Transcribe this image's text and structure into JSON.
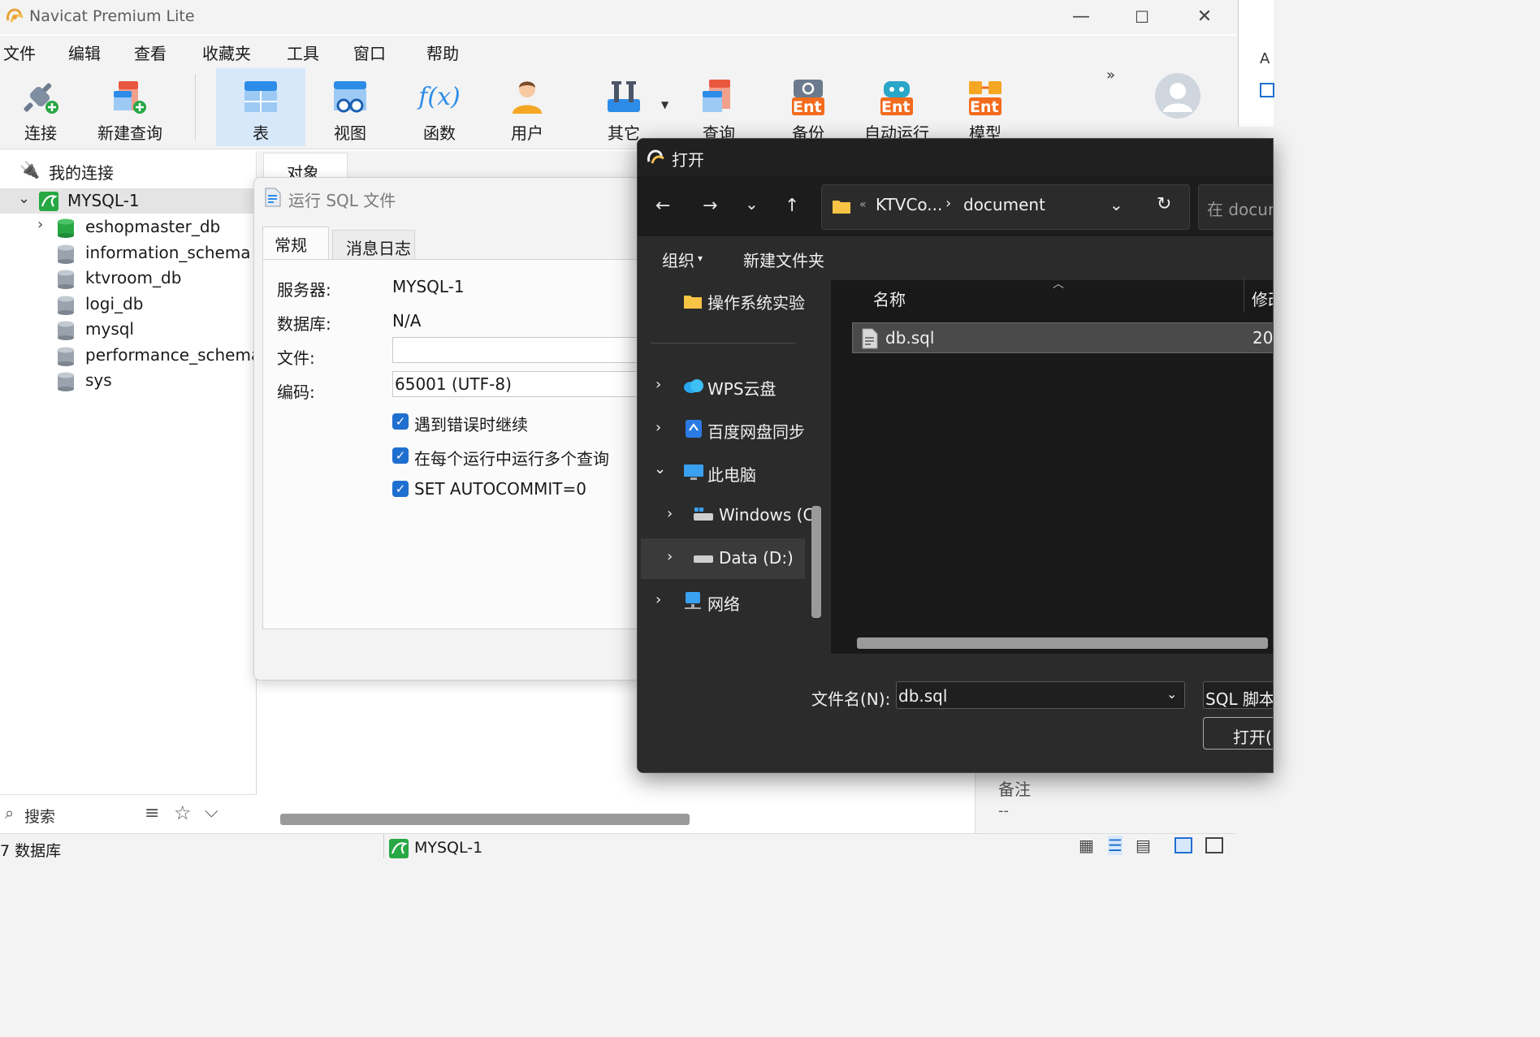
{
  "app": {
    "title": "Navicat Premium Lite",
    "window_controls": {
      "minimize": "—",
      "maximize": "☐",
      "close": "✕"
    }
  },
  "menu": [
    "文件",
    "编辑",
    "查看",
    "收藏夹",
    "工具",
    "窗口",
    "帮助"
  ],
  "toolbar": {
    "connect": "连接",
    "new_query": "新建查询",
    "table": "表",
    "view": "视图",
    "function": "函数",
    "user": "用户",
    "other": "其它",
    "query": "查询",
    "backup": "备份",
    "automation": "自动运行",
    "model": "模型",
    "ent_badge": "Ent",
    "overflow": "»",
    "function_glyph": "f(x)"
  },
  "navigator": {
    "header": "我的连接",
    "connection": "MYSQL-1",
    "databases": [
      "eshopmaster_db",
      "information_schema",
      "ktvroom_db",
      "logi_db",
      "mysql",
      "performance_schema",
      "sys"
    ],
    "search_label": "搜索"
  },
  "object_pane": {
    "tab": "对象",
    "remark_label": "备注",
    "remark_value": "--"
  },
  "statusbar": {
    "db_count": "7 数据库",
    "connection": "MYSQL-1"
  },
  "sql_dialog": {
    "title": "运行 SQL 文件",
    "tabs": [
      "常规",
      "消息日志"
    ],
    "server_label": "服务器:",
    "server_value": "MYSQL-1",
    "database_label": "数据库:",
    "database_value": "N/A",
    "file_label": "文件:",
    "file_value": "",
    "encoding_label": "编码:",
    "encoding_value": "65001 (UTF-8)",
    "options": [
      {
        "label": "遇到错误时继续",
        "checked": true
      },
      {
        "label": "在每个运行中运行多个查询",
        "checked": true
      },
      {
        "label": "SET AUTOCOMMIT=0",
        "checked": true
      }
    ]
  },
  "open_dialog": {
    "title": "打开",
    "breadcrumb": [
      "KTVCo...",
      "document"
    ],
    "search_placeholder": "在 docum",
    "organize": "组织",
    "new_folder": "新建文件夹",
    "sidebar": [
      "操作系统实验",
      "WPS云盘",
      "百度网盘同步",
      "此电脑",
      "Windows (C",
      "Data (D:)",
      "网络"
    ],
    "column_name": "名称",
    "column_modified": "修改",
    "files": [
      {
        "name": "db.sql",
        "date": "202"
      }
    ],
    "filename_label": "文件名(N):",
    "filename_value": "db.sql",
    "filetype": "SQL 脚本",
    "open_button": "打开("
  },
  "colors": {
    "accent": "#1f6fcf",
    "toolbar_active": "#d7e8fb",
    "dark_bg": "#202020",
    "dark_panel": "#2b2b2b"
  }
}
